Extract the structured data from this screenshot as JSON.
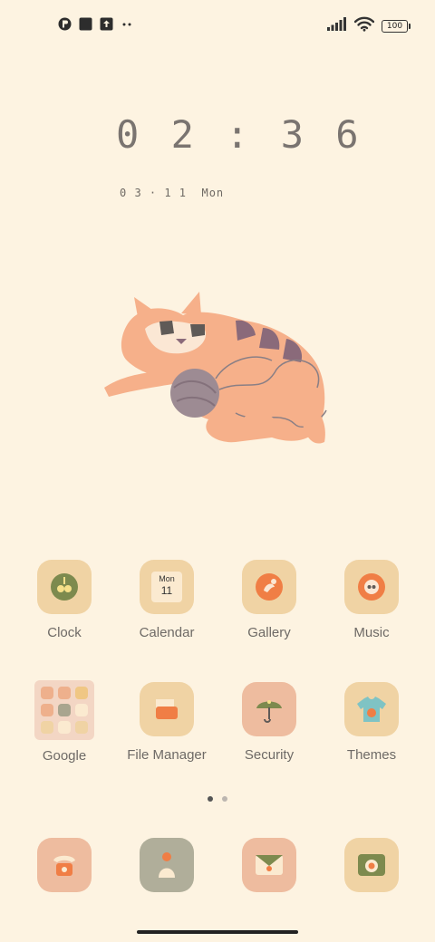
{
  "status_bar": {
    "left_icons": [
      "app-notification-icon",
      "square-notification-icon",
      "upload-notification-icon",
      "more-notifications-icon"
    ],
    "right_icons": [
      "signal-icon",
      "wifi-icon",
      "battery-icon"
    ],
    "battery": "100"
  },
  "lock_clock": {
    "time": "0 2 : 3 6",
    "date": "0 3 · 1 1  Mon"
  },
  "apps": [
    {
      "label": "Clock",
      "icon": "clock-icon"
    },
    {
      "label": "Calendar",
      "icon": "calendar-icon",
      "icon_text_day": "Mon",
      "icon_text_date": "11"
    },
    {
      "label": "Gallery",
      "icon": "gallery-icon"
    },
    {
      "label": "Music",
      "icon": "music-icon"
    },
    {
      "label": "Google",
      "icon": "google-folder-icon"
    },
    {
      "label": "File Manager",
      "icon": "folder-icon"
    },
    {
      "label": "Security",
      "icon": "umbrella-icon"
    },
    {
      "label": "Themes",
      "icon": "tshirt-icon"
    }
  ],
  "dock": [
    {
      "icon": "phone-icon"
    },
    {
      "icon": "contacts-icon"
    },
    {
      "icon": "messages-icon"
    },
    {
      "icon": "camera-icon"
    }
  ],
  "page_indicator": {
    "total": 2,
    "current": 1
  },
  "colors": {
    "background": "#fdf3e1",
    "icon_tan": "#f0d3a4",
    "icon_peach": "#eebc9f",
    "icon_sage": "#b0ae9a",
    "accent_orange": "#f07e45"
  }
}
